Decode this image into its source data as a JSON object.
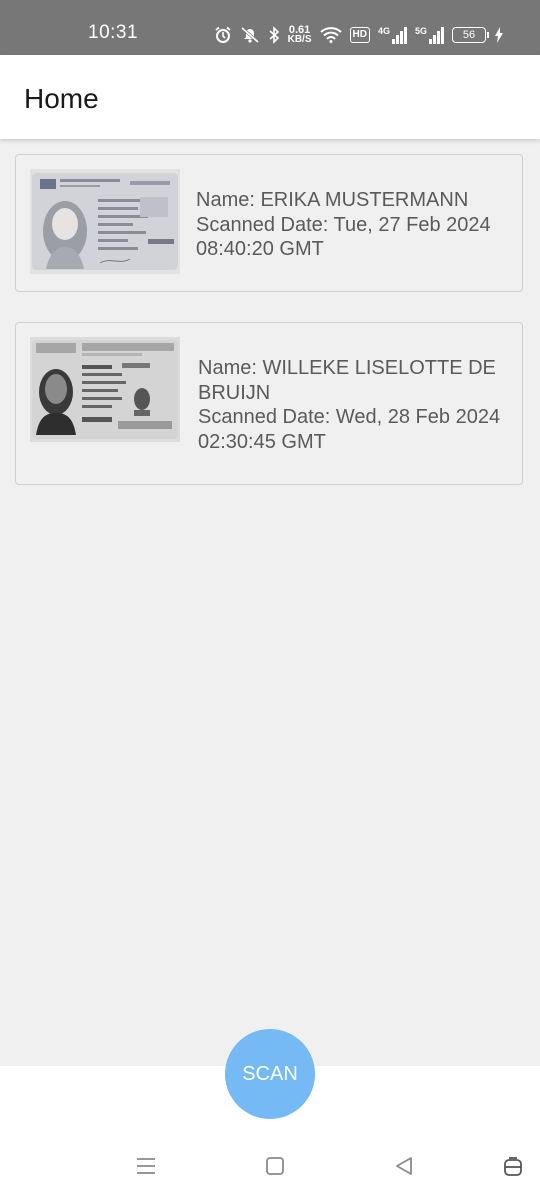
{
  "status_bar": {
    "time": "10:31",
    "net_speed_value": "0.61",
    "net_speed_unit": "KB/S",
    "hd_label": "HD",
    "signal_1_label": "4G",
    "signal_2_label": "5G",
    "battery_level": "56",
    "icons": [
      "alarm-icon",
      "mute-icon",
      "bluetooth-icon",
      "wifi-icon",
      "charging-icon"
    ]
  },
  "appbar": {
    "title": "Home"
  },
  "scans": [
    {
      "name": "Name: ERIKA MUSTERMANN",
      "scanned_date": "Scanned Date: Tue, 27 Feb 2024 08:40:20 GMT"
    },
    {
      "name": "Name: WILLEKE LISELOTTE DE BRUIJN",
      "scanned_date": "Scanned Date: Wed, 28 Feb 2024 02:30:45 GMT"
    }
  ],
  "scan_button": {
    "label": "SCAN"
  },
  "colors": {
    "status_bar": "#777777",
    "background": "#f0f0f0",
    "scan_button": "#75b9f5",
    "card_text": "#5a5a5a"
  },
  "navigation_bar": {
    "icons": [
      "menu-icon",
      "home-icon",
      "back-icon",
      "assistant-icon"
    ]
  }
}
